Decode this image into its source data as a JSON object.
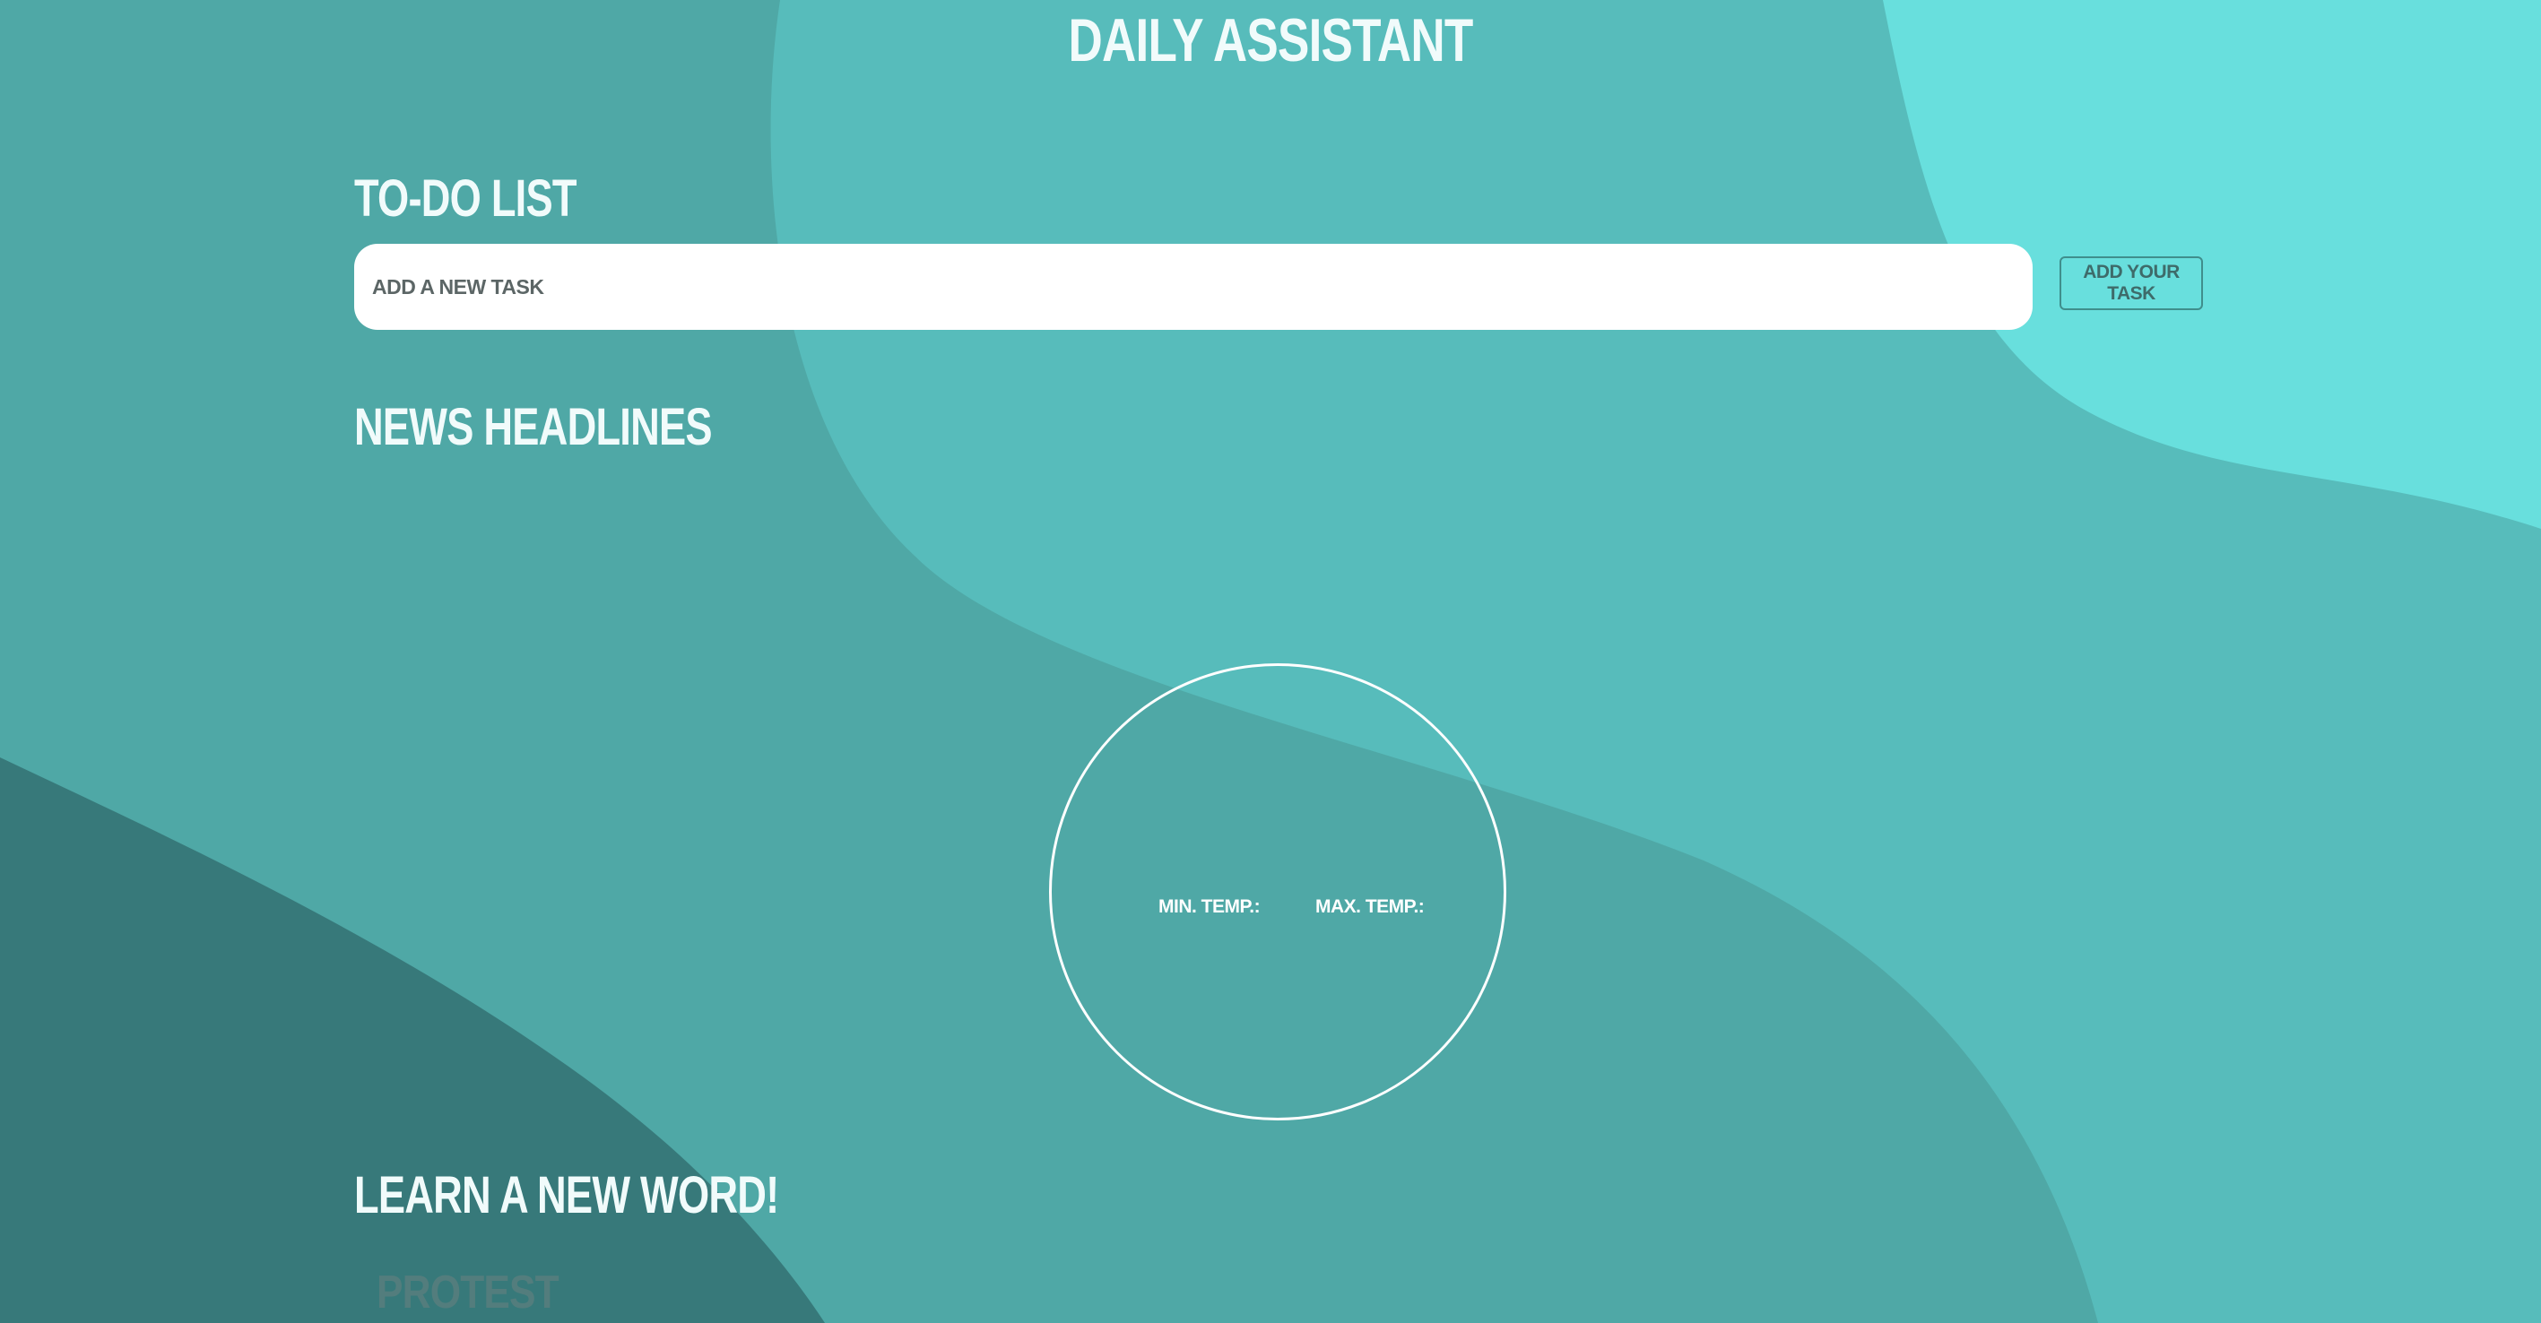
{
  "app": {
    "title": "DAILY ASSISTANT"
  },
  "todo": {
    "heading": "TO-DO LIST",
    "input_placeholder": "ADD A NEW TASK",
    "input_value": "",
    "add_button_label": "ADD YOUR TASK"
  },
  "news": {
    "heading": "NEWS HEADLINES",
    "headlines": []
  },
  "weather": {
    "min_temp_label": "MIN. TEMP.:",
    "max_temp_label": "MAX. TEMP.:"
  },
  "word_of_day": {
    "heading": "LEARN A NEW WORD!",
    "word": "PROTEST"
  },
  "colors": {
    "background_base": "#4fa8a6",
    "background_light": "#5bbfbe",
    "background_lightest": "#69e0de",
    "background_dark": "#37797a",
    "text_light": "#f1fbfb"
  }
}
